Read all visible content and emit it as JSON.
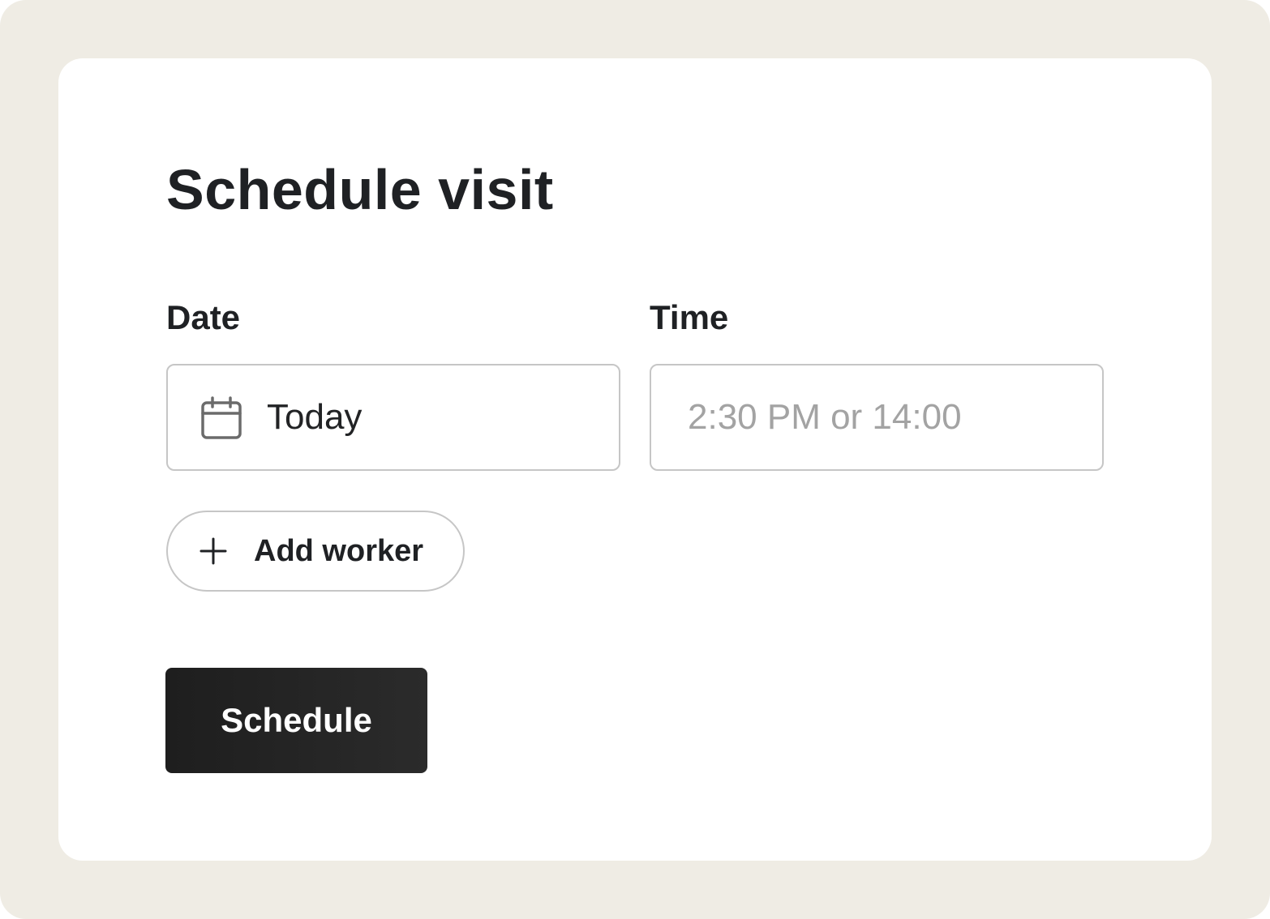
{
  "form": {
    "title": "Schedule visit",
    "date": {
      "label": "Date",
      "value": "Today",
      "icon": "calendar-icon"
    },
    "time": {
      "label": "Time",
      "value": "",
      "placeholder": "2:30 PM or 14:00"
    },
    "add_worker": {
      "label": "Add worker",
      "icon": "plus-icon"
    },
    "submit": {
      "label": "Schedule"
    }
  },
  "colors": {
    "frame_background": "#efece4",
    "card_background": "#ffffff",
    "text_primary": "#1f2124",
    "placeholder": "#a3a3a3",
    "border": "#c6c6c6",
    "button_background": "#222222",
    "button_text": "#ffffff"
  }
}
